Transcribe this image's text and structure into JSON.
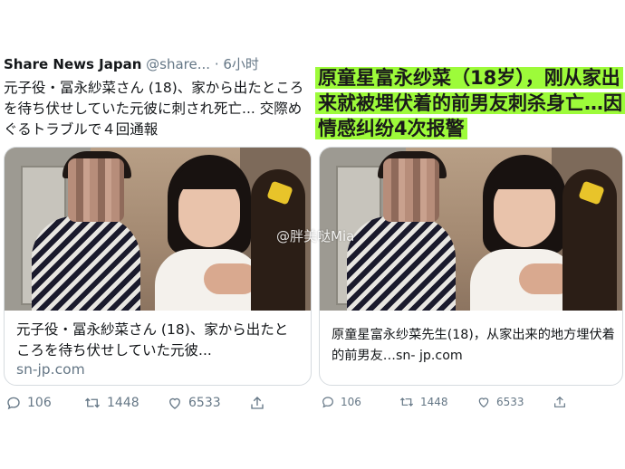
{
  "left_tweet": {
    "author_name": "Share News Japan",
    "author_handle": "@share...",
    "dot": "·",
    "time": "6小时",
    "text": "元子役・冨永紗菜さん (18)、家から出たところを待ち伏せしていた元彼に刺され死亡... 交際めぐるトラブルで４回通報",
    "card": {
      "title": "元子役・冨永紗菜さん (18)、家から出たところを待ち伏せしていた元彼...",
      "domain": "sn-jp.com"
    },
    "actions": {
      "reply_count": "106",
      "retweet_count": "1448",
      "like_count": "6533"
    }
  },
  "right_tweet": {
    "overlay_text": "原童星富永纱菜（18岁），刚从家出来就被埋伏着的前男友刺杀身亡…因情感纠纷4次报警",
    "card": {
      "title": "原童星富永纱菜先生(18)，从家出来的地方埋伏着的前男友…sn- jp.com"
    },
    "actions": {
      "reply_count": "106",
      "retweet_count": "1448",
      "like_count": "6533"
    }
  },
  "watermark": "@胖美哒Mia",
  "colors": {
    "overlay_highlight": "#9dfb3a",
    "muted_text": "#657786"
  }
}
